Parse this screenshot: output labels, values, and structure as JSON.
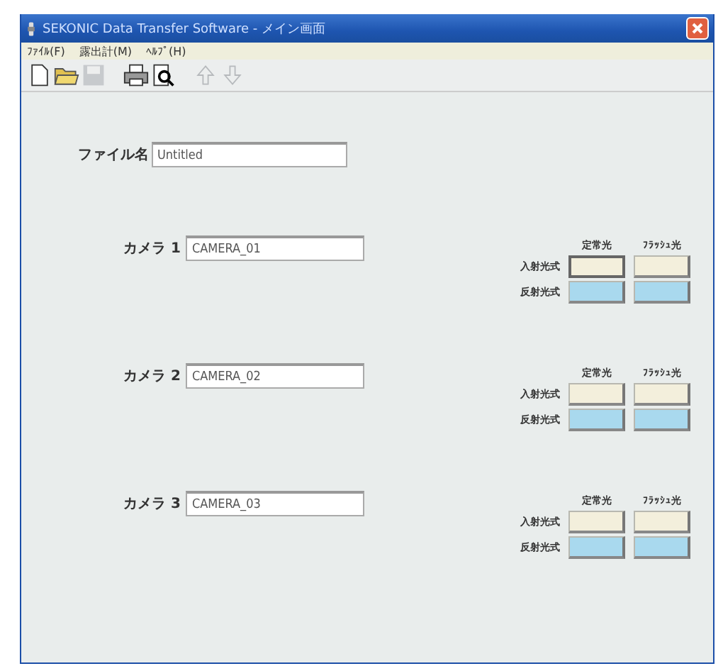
{
  "window": {
    "title": "SEKONIC Data Transfer Software - メイン画面"
  },
  "menu": [
    {
      "label": "ﾌｧｲﾙ(F)"
    },
    {
      "label": "露出計(M)"
    },
    {
      "label": "ﾍﾙﾌﾟ(H)"
    }
  ],
  "toolbar": [
    {
      "kind": "new",
      "disabled": false
    },
    {
      "kind": "open",
      "disabled": false
    },
    {
      "kind": "save",
      "disabled": true
    },
    {
      "kind": "print",
      "disabled": false
    },
    {
      "kind": "preview",
      "disabled": false
    },
    {
      "kind": "up",
      "disabled": true
    },
    {
      "kind": "down",
      "disabled": true
    }
  ],
  "file": {
    "label": "ファイル名",
    "value": "Untitled"
  },
  "cameras": [
    {
      "label": "カメラ 1",
      "value": "CAMERA_01",
      "column_headers": [
        "定常光",
        "ﾌﾗｯｼｭ光"
      ],
      "rows": [
        {
          "label": "入射光式",
          "kind": "incident",
          "buttons": [
            {
              "selected": true
            },
            {
              "selected": false
            }
          ]
        },
        {
          "label": "反射光式",
          "kind": "reflected",
          "buttons": [
            {
              "selected": false
            },
            {
              "selected": false
            }
          ]
        }
      ]
    },
    {
      "label": "カメラ 2",
      "value": "CAMERA_02",
      "column_headers": [
        "定常光",
        "ﾌﾗｯｼｭ光"
      ],
      "rows": [
        {
          "label": "入射光式",
          "kind": "incident",
          "buttons": [
            {
              "selected": false
            },
            {
              "selected": false
            }
          ]
        },
        {
          "label": "反射光式",
          "kind": "reflected",
          "buttons": [
            {
              "selected": false
            },
            {
              "selected": false
            }
          ]
        }
      ]
    },
    {
      "label": "カメラ 3",
      "value": "CAMERA_03",
      "column_headers": [
        "定常光",
        "ﾌﾗｯｼｭ光"
      ],
      "rows": [
        {
          "label": "入射光式",
          "kind": "incident",
          "buttons": [
            {
              "selected": false
            },
            {
              "selected": false
            }
          ]
        },
        {
          "label": "反射光式",
          "kind": "reflected",
          "buttons": [
            {
              "selected": false
            },
            {
              "selected": false
            }
          ]
        }
      ]
    }
  ]
}
